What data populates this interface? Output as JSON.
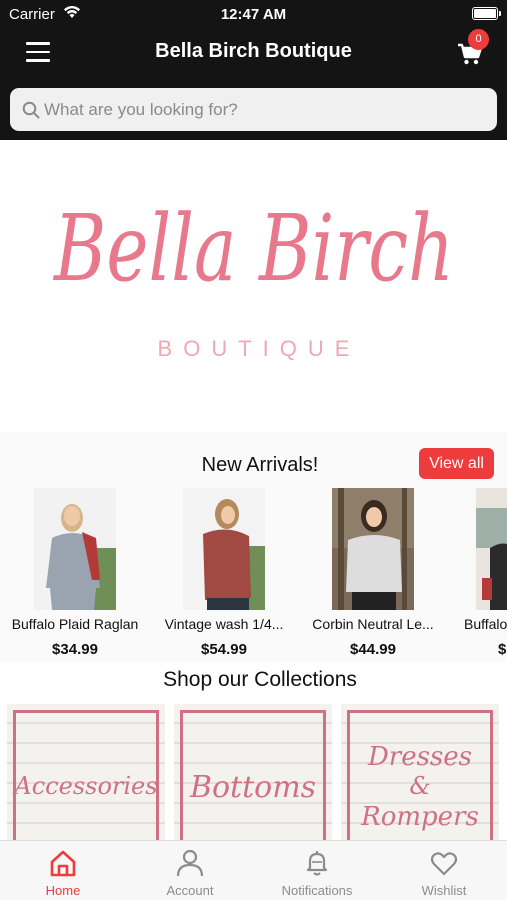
{
  "status_bar": {
    "carrier": "Carrier",
    "time": "12:47 AM"
  },
  "header": {
    "title": "Bella Birch Boutique",
    "cart_count": "0"
  },
  "search": {
    "placeholder": "What are you looking for?"
  },
  "banner": {
    "logo_script": "Bella Birch",
    "logo_sub": "BOUTIQUE"
  },
  "new_arrivals": {
    "title": "New Arrivals!",
    "view_all_label": "View all",
    "products": [
      {
        "name": "Buffalo Plaid Raglan",
        "price": "$34.99"
      },
      {
        "name": "Vintage wash 1/4...",
        "price": "$54.99"
      },
      {
        "name": "Corbin Neutral Le...",
        "price": "$44.99"
      },
      {
        "name": "Buffalo",
        "price": "$"
      }
    ]
  },
  "collections": {
    "title": "Shop our Collections",
    "items": [
      {
        "label": "Accessories"
      },
      {
        "label": "Bottoms"
      },
      {
        "label_line1": "Dresses",
        "label_line2": "&",
        "label_line3": "Rompers"
      }
    ]
  },
  "tab_bar": {
    "tabs": [
      {
        "label": "Home",
        "icon": "home-icon",
        "active": true
      },
      {
        "label": "Account",
        "icon": "person-icon",
        "active": false
      },
      {
        "label": "Notifications",
        "icon": "bell-icon",
        "active": false
      },
      {
        "label": "Wishlist",
        "icon": "heart-icon",
        "active": false
      }
    ]
  },
  "colors": {
    "accent": "#ee3b3b",
    "logo_pink": "#e8798d",
    "dark_bar": "#141414"
  }
}
